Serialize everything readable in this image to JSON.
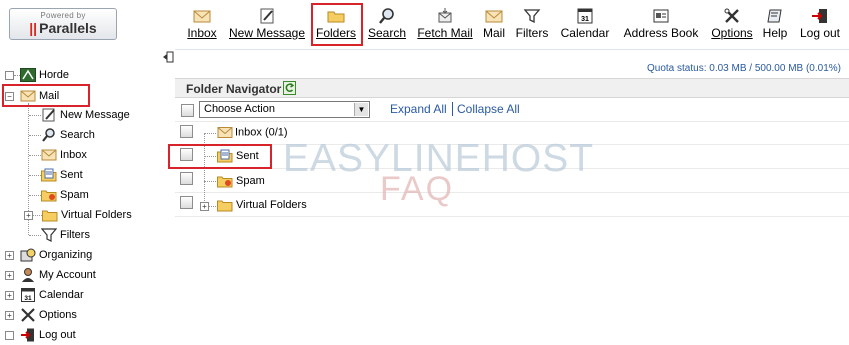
{
  "logo": {
    "powered_by": "Powered by",
    "brand": "Parallels"
  },
  "toolbar": {
    "items": [
      {
        "label": "Inbox",
        "icon": "envelope-icon"
      },
      {
        "label": "New Message",
        "icon": "compose-icon"
      },
      {
        "label": "Folders",
        "icon": "folder-icon"
      },
      {
        "label": "Search",
        "icon": "magnifier-icon"
      },
      {
        "label": "Fetch Mail",
        "icon": "fetch-mail-icon"
      },
      {
        "label": "Mail",
        "icon": "envelope-icon"
      },
      {
        "label": "Filters",
        "icon": "funnel-icon"
      },
      {
        "label": "Calendar",
        "icon": "calendar-icon"
      },
      {
        "label": "Address Book",
        "icon": "address-book-icon"
      },
      {
        "label": "Options",
        "icon": "tools-icon"
      },
      {
        "label": "Help",
        "icon": "book-icon"
      },
      {
        "label": "Log out",
        "icon": "logout-icon"
      }
    ],
    "calendar_day": "31"
  },
  "sidebar": {
    "items": [
      {
        "label": "Horde",
        "icon": "horde-icon"
      },
      {
        "label": "Mail",
        "icon": "envelope-icon"
      },
      {
        "label": "New Message",
        "icon": "compose-icon"
      },
      {
        "label": "Search",
        "icon": "magnifier-icon"
      },
      {
        "label": "Inbox",
        "icon": "envelope-icon"
      },
      {
        "label": "Sent",
        "icon": "sent-icon"
      },
      {
        "label": "Spam",
        "icon": "spam-folder-icon"
      },
      {
        "label": "Virtual Folders",
        "icon": "folder-icon"
      },
      {
        "label": "Filters",
        "icon": "funnel-icon"
      },
      {
        "label": "Organizing",
        "icon": "organizing-icon"
      },
      {
        "label": "My Account",
        "icon": "account-icon"
      },
      {
        "label": "Calendar",
        "icon": "calendar-icon"
      },
      {
        "label": "Options",
        "icon": "tools-icon"
      },
      {
        "label": "Log out",
        "icon": "logout-icon"
      }
    ]
  },
  "main": {
    "quota": "Quota status: 0.03 MB / 500.00 MB (0.01%)",
    "title": "Folder Navigator",
    "action_select": "Choose Action",
    "expand_all": "Expand All",
    "collapse_all": "Collapse All",
    "folders": [
      {
        "label": "Inbox (0/1)",
        "icon": "envelope-icon"
      },
      {
        "label": "Sent",
        "icon": "sent-icon"
      },
      {
        "label": "Spam",
        "icon": "spam-folder-icon"
      },
      {
        "label": "Virtual Folders",
        "icon": "folder-icon"
      }
    ],
    "watermark_line1": "EASYLINEHOST",
    "watermark_line2": "FAQ"
  },
  "colors": {
    "highlight": "#d8232a",
    "link": "#2a5aa0",
    "folder": "#f2c04a"
  }
}
